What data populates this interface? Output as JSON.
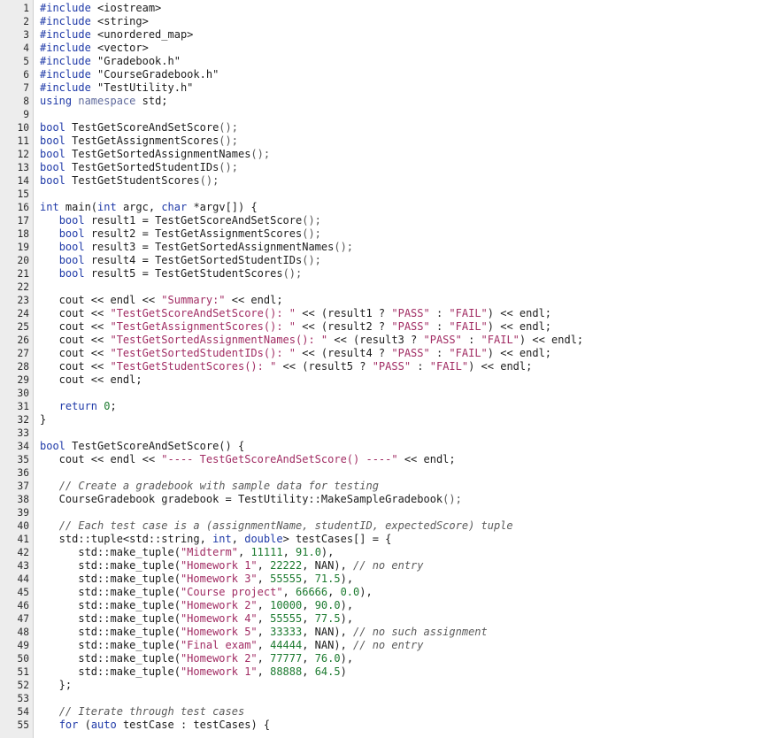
{
  "editor": {
    "line_numbers": [
      "1",
      "2",
      "3",
      "4",
      "5",
      "6",
      "7",
      "8",
      "9",
      "10",
      "11",
      "12",
      "13",
      "14",
      "15",
      "16",
      "17",
      "18",
      "19",
      "20",
      "21",
      "22",
      "23",
      "24",
      "25",
      "26",
      "27",
      "28",
      "29",
      "30",
      "31",
      "32",
      "33",
      "34",
      "35",
      "36",
      "37",
      "38",
      "39",
      "40",
      "41",
      "42",
      "43",
      "44",
      "45",
      "46",
      "47",
      "48",
      "49",
      "50",
      "51",
      "52",
      "53",
      "54",
      "55"
    ],
    "lines": [
      [
        [
          "pre",
          "#include"
        ],
        [
          "inc",
          " <iostream>"
        ]
      ],
      [
        [
          "pre",
          "#include"
        ],
        [
          "inc",
          " <string>"
        ]
      ],
      [
        [
          "pre",
          "#include"
        ],
        [
          "inc",
          " <unordered_map>"
        ]
      ],
      [
        [
          "pre",
          "#include"
        ],
        [
          "inc",
          " <vector>"
        ]
      ],
      [
        [
          "pre",
          "#include"
        ],
        [
          "inc",
          " \"Gradebook.h\""
        ]
      ],
      [
        [
          "pre",
          "#include"
        ],
        [
          "inc",
          " \"CourseGradebook.h\""
        ]
      ],
      [
        [
          "pre",
          "#include"
        ],
        [
          "inc",
          " \"TestUtility.h\""
        ]
      ],
      [
        [
          "kw",
          "using"
        ],
        [
          "id",
          " "
        ],
        [
          "ns",
          "namespace"
        ],
        [
          "id",
          " std;"
        ]
      ],
      [],
      [
        [
          "kw",
          "bool"
        ],
        [
          "id",
          " TestGetScoreAndSetScore"
        ],
        [
          "op",
          "();"
        ]
      ],
      [
        [
          "kw",
          "bool"
        ],
        [
          "id",
          " TestGetAssignmentScores"
        ],
        [
          "op",
          "();"
        ]
      ],
      [
        [
          "kw",
          "bool"
        ],
        [
          "id",
          " TestGetSortedAssignmentNames"
        ],
        [
          "op",
          "();"
        ]
      ],
      [
        [
          "kw",
          "bool"
        ],
        [
          "id",
          " TestGetSortedStudentIDs"
        ],
        [
          "op",
          "();"
        ]
      ],
      [
        [
          "kw",
          "bool"
        ],
        [
          "id",
          " TestGetStudentScores"
        ],
        [
          "op",
          "();"
        ]
      ],
      [],
      [
        [
          "kw",
          "int"
        ],
        [
          "id",
          " main("
        ],
        [
          "kw",
          "int"
        ],
        [
          "id",
          " argc, "
        ],
        [
          "kw",
          "char"
        ],
        [
          "id",
          " *argv[]) {"
        ]
      ],
      [
        [
          "id",
          "   "
        ],
        [
          "kw",
          "bool"
        ],
        [
          "id",
          " result1 = TestGetScoreAndSetScore"
        ],
        [
          "op",
          "();"
        ]
      ],
      [
        [
          "id",
          "   "
        ],
        [
          "kw",
          "bool"
        ],
        [
          "id",
          " result2 = TestGetAssignmentScores"
        ],
        [
          "op",
          "();"
        ]
      ],
      [
        [
          "id",
          "   "
        ],
        [
          "kw",
          "bool"
        ],
        [
          "id",
          " result3 = TestGetSortedAssignmentNames"
        ],
        [
          "op",
          "();"
        ]
      ],
      [
        [
          "id",
          "   "
        ],
        [
          "kw",
          "bool"
        ],
        [
          "id",
          " result4 = TestGetSortedStudentIDs"
        ],
        [
          "op",
          "();"
        ]
      ],
      [
        [
          "id",
          "   "
        ],
        [
          "kw",
          "bool"
        ],
        [
          "id",
          " result5 = TestGetStudentScores"
        ],
        [
          "op",
          "();"
        ]
      ],
      [],
      [
        [
          "id",
          "   cout << endl << "
        ],
        [
          "str",
          "\"Summary:\""
        ],
        [
          "id",
          " << endl;"
        ]
      ],
      [
        [
          "id",
          "   cout << "
        ],
        [
          "str",
          "\"TestGetScoreAndSetScore(): \""
        ],
        [
          "id",
          " << (result1 ? "
        ],
        [
          "str",
          "\"PASS\""
        ],
        [
          "id",
          " : "
        ],
        [
          "str",
          "\"FAIL\""
        ],
        [
          "id",
          ") << endl;"
        ]
      ],
      [
        [
          "id",
          "   cout << "
        ],
        [
          "str",
          "\"TestGetAssignmentScores(): \""
        ],
        [
          "id",
          " << (result2 ? "
        ],
        [
          "str",
          "\"PASS\""
        ],
        [
          "id",
          " : "
        ],
        [
          "str",
          "\"FAIL\""
        ],
        [
          "id",
          ") << endl;"
        ]
      ],
      [
        [
          "id",
          "   cout << "
        ],
        [
          "str",
          "\"TestGetSortedAssignmentNames(): \""
        ],
        [
          "id",
          " << (result3 ? "
        ],
        [
          "str",
          "\"PASS\""
        ],
        [
          "id",
          " : "
        ],
        [
          "str",
          "\"FAIL\""
        ],
        [
          "id",
          ") << endl;"
        ]
      ],
      [
        [
          "id",
          "   cout << "
        ],
        [
          "str",
          "\"TestGetSortedStudentIDs(): \""
        ],
        [
          "id",
          " << (result4 ? "
        ],
        [
          "str",
          "\"PASS\""
        ],
        [
          "id",
          " : "
        ],
        [
          "str",
          "\"FAIL\""
        ],
        [
          "id",
          ") << endl;"
        ]
      ],
      [
        [
          "id",
          "   cout << "
        ],
        [
          "str",
          "\"TestGetStudentScores(): \""
        ],
        [
          "id",
          " << (result5 ? "
        ],
        [
          "str",
          "\"PASS\""
        ],
        [
          "id",
          " : "
        ],
        [
          "str",
          "\"FAIL\""
        ],
        [
          "id",
          ") << endl;"
        ]
      ],
      [
        [
          "id",
          "   cout << endl;"
        ]
      ],
      [],
      [
        [
          "id",
          "   "
        ],
        [
          "kw",
          "return"
        ],
        [
          "id",
          " "
        ],
        [
          "num",
          "0"
        ],
        [
          "id",
          ";"
        ]
      ],
      [
        [
          "id",
          "}"
        ]
      ],
      [],
      [
        [
          "kw",
          "bool"
        ],
        [
          "id",
          " TestGetScoreAndSetScore() {"
        ]
      ],
      [
        [
          "id",
          "   cout << endl << "
        ],
        [
          "str",
          "\"---- TestGetScoreAndSetScore() ----\""
        ],
        [
          "id",
          " << endl;"
        ]
      ],
      [],
      [
        [
          "id",
          "   "
        ],
        [
          "com",
          "// Create a gradebook with sample data for testing"
        ]
      ],
      [
        [
          "id",
          "   CourseGradebook gradebook = TestUtility::MakeSampleGradebook"
        ],
        [
          "op",
          "();"
        ]
      ],
      [],
      [
        [
          "id",
          "   "
        ],
        [
          "com",
          "// Each test case is a (assignmentName, studentID, expectedScore) tuple"
        ]
      ],
      [
        [
          "id",
          "   std::tuple<std::string, "
        ],
        [
          "kw",
          "int"
        ],
        [
          "id",
          ", "
        ],
        [
          "kw",
          "double"
        ],
        [
          "id",
          "> testCases[] = {"
        ]
      ],
      [
        [
          "id",
          "      std::make_tuple("
        ],
        [
          "str",
          "\"Midterm\""
        ],
        [
          "id",
          ", "
        ],
        [
          "num",
          "11111"
        ],
        [
          "id",
          ", "
        ],
        [
          "num",
          "91.0"
        ],
        [
          "id",
          "),"
        ]
      ],
      [
        [
          "id",
          "      std::make_tuple("
        ],
        [
          "str",
          "\"Homework 1\""
        ],
        [
          "id",
          ", "
        ],
        [
          "num",
          "22222"
        ],
        [
          "id",
          ", NAN), "
        ],
        [
          "com",
          "// no entry"
        ]
      ],
      [
        [
          "id",
          "      std::make_tuple("
        ],
        [
          "str",
          "\"Homework 3\""
        ],
        [
          "id",
          ", "
        ],
        [
          "num",
          "55555"
        ],
        [
          "id",
          ", "
        ],
        [
          "num",
          "71.5"
        ],
        [
          "id",
          "),"
        ]
      ],
      [
        [
          "id",
          "      std::make_tuple("
        ],
        [
          "str",
          "\"Course project\""
        ],
        [
          "id",
          ", "
        ],
        [
          "num",
          "66666"
        ],
        [
          "id",
          ", "
        ],
        [
          "num",
          "0.0"
        ],
        [
          "id",
          "),"
        ]
      ],
      [
        [
          "id",
          "      std::make_tuple("
        ],
        [
          "str",
          "\"Homework 2\""
        ],
        [
          "id",
          ", "
        ],
        [
          "num",
          "10000"
        ],
        [
          "id",
          ", "
        ],
        [
          "num",
          "90.0"
        ],
        [
          "id",
          "),"
        ]
      ],
      [
        [
          "id",
          "      std::make_tuple("
        ],
        [
          "str",
          "\"Homework 4\""
        ],
        [
          "id",
          ", "
        ],
        [
          "num",
          "55555"
        ],
        [
          "id",
          ", "
        ],
        [
          "num",
          "77.5"
        ],
        [
          "id",
          "),"
        ]
      ],
      [
        [
          "id",
          "      std::make_tuple("
        ],
        [
          "str",
          "\"Homework 5\""
        ],
        [
          "id",
          ", "
        ],
        [
          "num",
          "33333"
        ],
        [
          "id",
          ", NAN), "
        ],
        [
          "com",
          "// no such assignment"
        ]
      ],
      [
        [
          "id",
          "      std::make_tuple("
        ],
        [
          "str",
          "\"Final exam\""
        ],
        [
          "id",
          ", "
        ],
        [
          "num",
          "44444"
        ],
        [
          "id",
          ", NAN), "
        ],
        [
          "com",
          "// no entry"
        ]
      ],
      [
        [
          "id",
          "      std::make_tuple("
        ],
        [
          "str",
          "\"Homework 2\""
        ],
        [
          "id",
          ", "
        ],
        [
          "num",
          "77777"
        ],
        [
          "id",
          ", "
        ],
        [
          "num",
          "76.0"
        ],
        [
          "id",
          "),"
        ]
      ],
      [
        [
          "id",
          "      std::make_tuple("
        ],
        [
          "str",
          "\"Homework 1\""
        ],
        [
          "id",
          ", "
        ],
        [
          "num",
          "88888"
        ],
        [
          "id",
          ", "
        ],
        [
          "num",
          "64.5"
        ],
        [
          "id",
          ")"
        ]
      ],
      [
        [
          "id",
          "   };"
        ]
      ],
      [],
      [
        [
          "id",
          "   "
        ],
        [
          "com",
          "// Iterate through test cases"
        ]
      ],
      [
        [
          "id",
          "   "
        ],
        [
          "kw",
          "for"
        ],
        [
          "id",
          " ("
        ],
        [
          "kw",
          "auto"
        ],
        [
          "id",
          " testCase : testCases) {"
        ]
      ]
    ]
  }
}
